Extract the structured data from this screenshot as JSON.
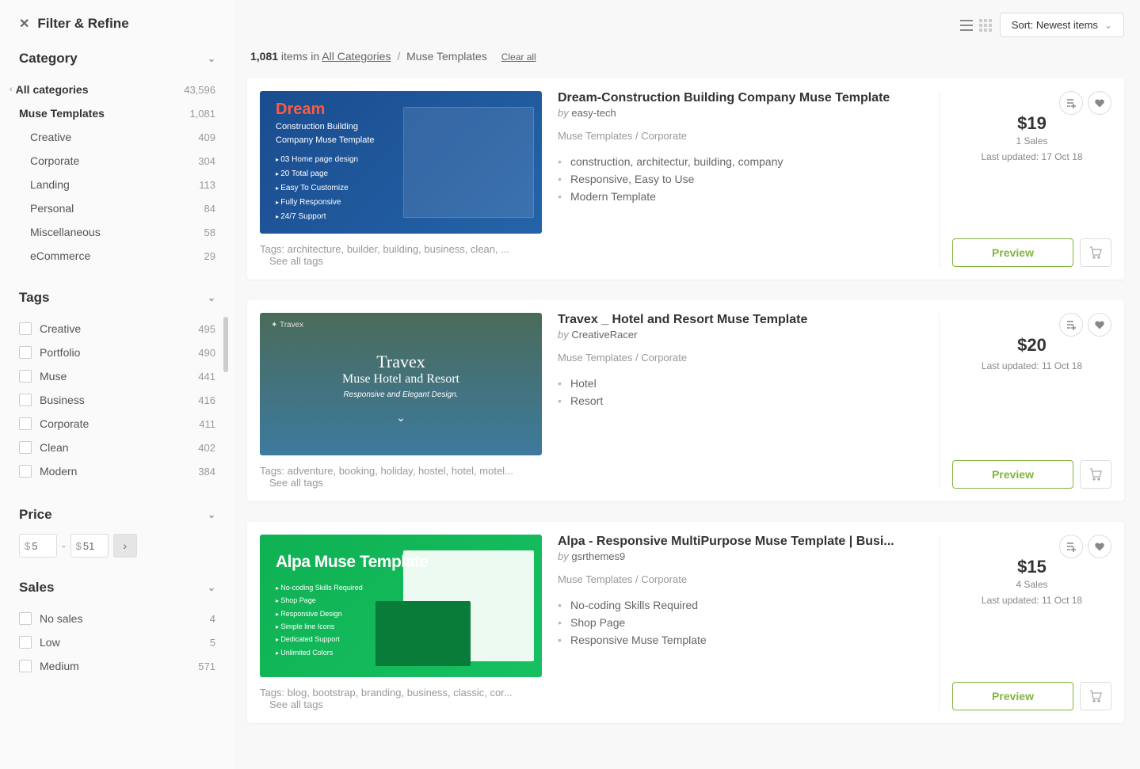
{
  "filter_title": "Filter & Refine",
  "sections": {
    "category": "Category",
    "tags": "Tags",
    "price": "Price",
    "sales": "Sales"
  },
  "categories": {
    "all": {
      "label": "All categories",
      "count": "43,596"
    },
    "current": {
      "label": "Muse Templates",
      "count": "1,081"
    },
    "subs": [
      {
        "label": "Creative",
        "count": "409"
      },
      {
        "label": "Corporate",
        "count": "304"
      },
      {
        "label": "Landing",
        "count": "113"
      },
      {
        "label": "Personal",
        "count": "84"
      },
      {
        "label": "Miscellaneous",
        "count": "58"
      },
      {
        "label": "eCommerce",
        "count": "29"
      }
    ]
  },
  "tags": [
    {
      "label": "Creative",
      "count": "495"
    },
    {
      "label": "Portfolio",
      "count": "490"
    },
    {
      "label": "Muse",
      "count": "441"
    },
    {
      "label": "Business",
      "count": "416"
    },
    {
      "label": "Corporate",
      "count": "411"
    },
    {
      "label": "Clean",
      "count": "402"
    },
    {
      "label": "Modern",
      "count": "384"
    }
  ],
  "price": {
    "currency": "$",
    "min": "5",
    "max": "51",
    "dash": "-"
  },
  "sales_filters": [
    {
      "label": "No sales",
      "count": "4"
    },
    {
      "label": "Low",
      "count": "5"
    },
    {
      "label": "Medium",
      "count": "571"
    }
  ],
  "sort": {
    "prefix": "Sort: ",
    "value": "Newest items"
  },
  "breadcrumb": {
    "count": "1,081",
    "items_in": " items in  ",
    "all": "All Categories",
    "sep": " / ",
    "current": "Muse Templates",
    "clear": "Clear all"
  },
  "labels": {
    "by": "by ",
    "tags_prefix": "Tags: ",
    "see_all": "See all tags",
    "preview": "Preview",
    "last_updated": "Last updated: "
  },
  "items": [
    {
      "title": "Dream-Construction Building Company Muse Template",
      "author": "easy-tech",
      "category": "Muse Templates / Corporate",
      "features": [
        "construction, architectur, building, company",
        "Responsive, Easy to Use",
        "Modern Template"
      ],
      "tags": "architecture, builder, building, business, clean, ...",
      "price": "$19",
      "sales": "1 Sales",
      "updated": "17 Oct 18",
      "thumb": {
        "brand": "Dream",
        "sub": "Construction Building\nCompany Muse Template",
        "bullets": [
          "03 Home page design",
          "20 Total page",
          "Easy To Customize",
          "Fully Responsive",
          "24/7 Support"
        ]
      }
    },
    {
      "title": "Travex _ Hotel and Resort Muse Template",
      "author": "CreativeRacer",
      "category": "Muse Templates / Corporate",
      "features": [
        "Hotel",
        "Resort"
      ],
      "tags": "adventure, booking, holiday, hostel, hotel, motel...",
      "price": "$20",
      "sales": "",
      "updated": "11 Oct 18",
      "thumb": {
        "title": "Travex",
        "sub2": "Muse Hotel and Resort",
        "tag": "Responsive and Elegant Design."
      }
    },
    {
      "title": "Alpa - Responsive MultiPurpose Muse Template | Busi...",
      "author": "gsrthemes9",
      "category": "Muse Templates / Corporate",
      "features": [
        "No-coding Skills Required",
        "Shop Page",
        "Responsive Muse Template"
      ],
      "tags": "blog, bootstrap, branding, business, classic, cor...",
      "price": "$15",
      "sales": "4 Sales",
      "updated": "11 Oct 18",
      "thumb": {
        "t3title": "Alpa Muse Template",
        "bullets": [
          "No-coding Skills Required",
          "Shop Page",
          "Responsive Design",
          "Simple line Icons",
          "Dedicated Support",
          "Unlimited Colors"
        ]
      }
    }
  ]
}
